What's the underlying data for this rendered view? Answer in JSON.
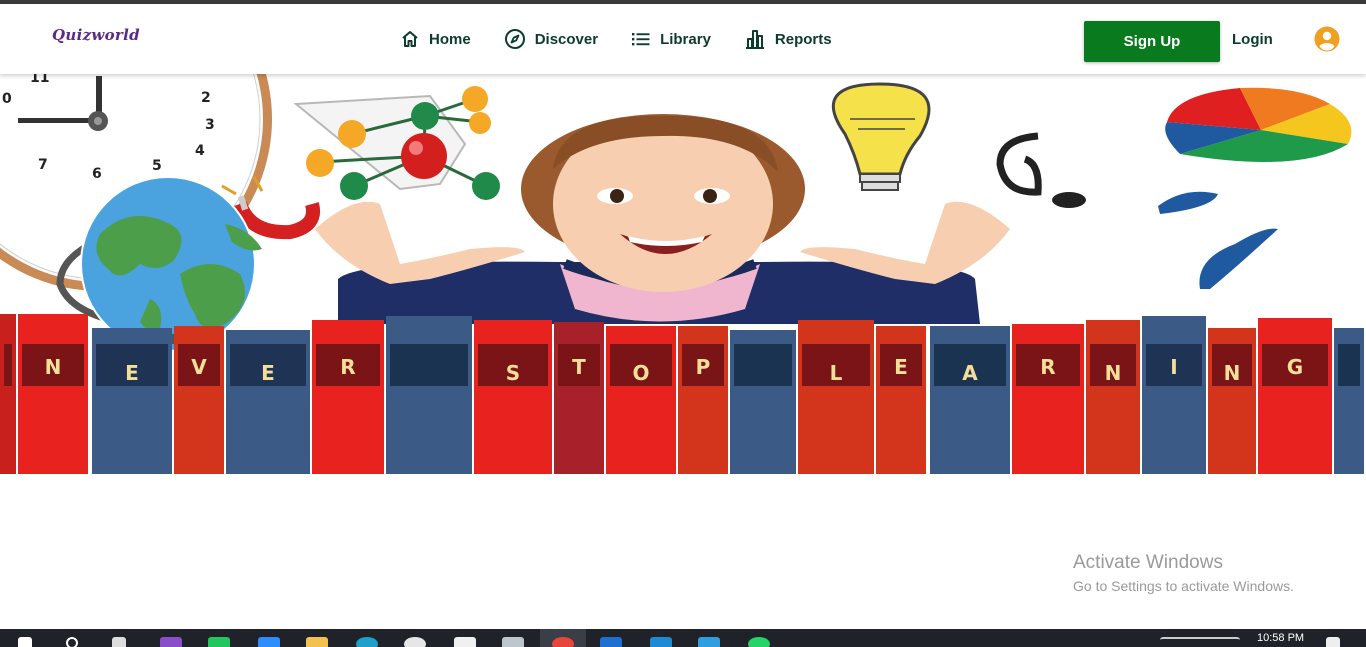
{
  "brand": {
    "logo_text": "Quizworld"
  },
  "nav": {
    "items": [
      {
        "label": "Home",
        "icon": "home-icon"
      },
      {
        "label": "Discover",
        "icon": "compass-icon"
      },
      {
        "label": "Library",
        "icon": "list-icon"
      },
      {
        "label": "Reports",
        "icon": "bar-chart-icon"
      }
    ]
  },
  "auth": {
    "signup_label": "Sign Up",
    "login_label": "Login",
    "avatar_icon": "user-circle-icon"
  },
  "hero": {
    "book_letters": [
      "N",
      "E",
      "V",
      "E",
      "R",
      "S",
      "T",
      "O",
      "P",
      "L",
      "E",
      "A",
      "R",
      "N",
      "I",
      "N",
      "G"
    ]
  },
  "watermark": {
    "title": "Activate Windows",
    "subtitle": "Go to Settings to activate Windows."
  },
  "taskbar": {
    "time": "10:58 PM"
  },
  "colors": {
    "accent_green": "#0a7a1f",
    "nav_text": "#0d3b2e",
    "avatar_orange": "#f0a020"
  }
}
